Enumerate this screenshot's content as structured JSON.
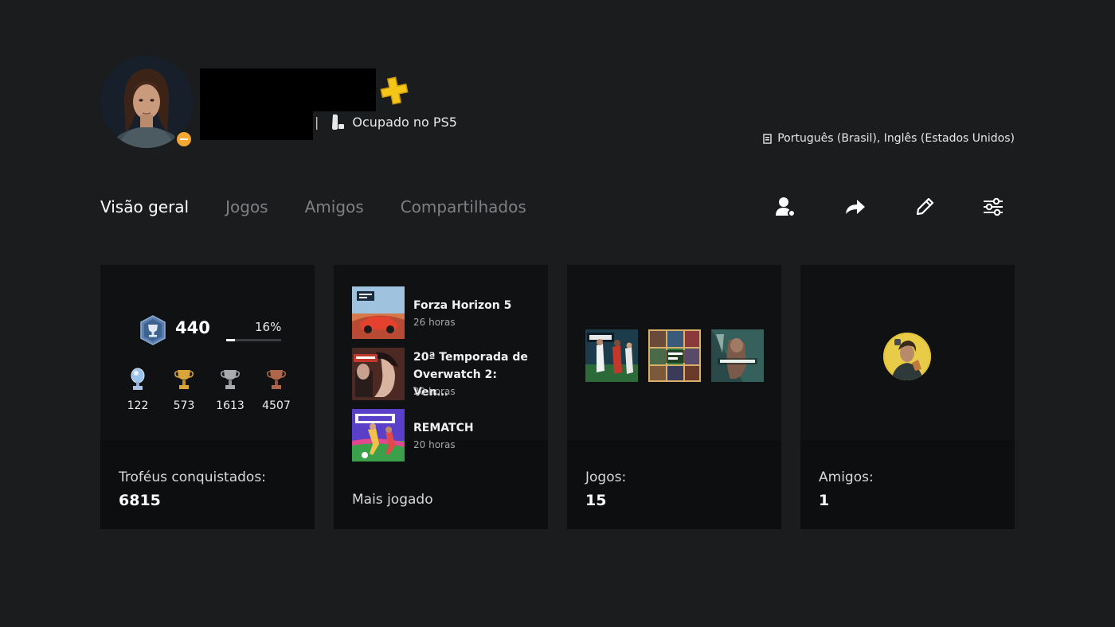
{
  "header": {
    "presence_separator": "|",
    "presence_text": "Ocupado no PS5",
    "languages": "Português (Brasil), Inglês (Estados Unidos)",
    "status_color": "#f2a833",
    "plus_color": "#f5c518"
  },
  "tabs": [
    {
      "label": "Visão geral",
      "active": true
    },
    {
      "label": "Jogos",
      "active": false
    },
    {
      "label": "Amigos",
      "active": false
    },
    {
      "label": "Compartilhados",
      "active": false
    }
  ],
  "actions": [
    {
      "icon": "add-friend-icon"
    },
    {
      "icon": "share-icon"
    },
    {
      "icon": "edit-icon"
    },
    {
      "icon": "settings-sliders-icon"
    }
  ],
  "trophies": {
    "level": "440",
    "progress_label": "16%",
    "progress": 0.16,
    "platinum": "122",
    "gold": "573",
    "silver": "1613",
    "bronze": "4507",
    "caption": "Troféus conquistados:",
    "total": "6815"
  },
  "most_played": {
    "caption": "Mais jogado",
    "items": [
      {
        "title": "Forza Horizon 5",
        "hours": "26 horas"
      },
      {
        "title": "20ª Temporada de Overwatch 2: Ven…",
        "hours": "20 horas"
      },
      {
        "title": "REMATCH",
        "hours": "20 horas"
      }
    ]
  },
  "games": {
    "caption": "Jogos:",
    "count": "15",
    "thumbs": [
      "FC 26",
      "Grand Theft Auto V",
      "Valorant"
    ]
  },
  "friends": {
    "caption": "Amigos:",
    "count": "1"
  }
}
